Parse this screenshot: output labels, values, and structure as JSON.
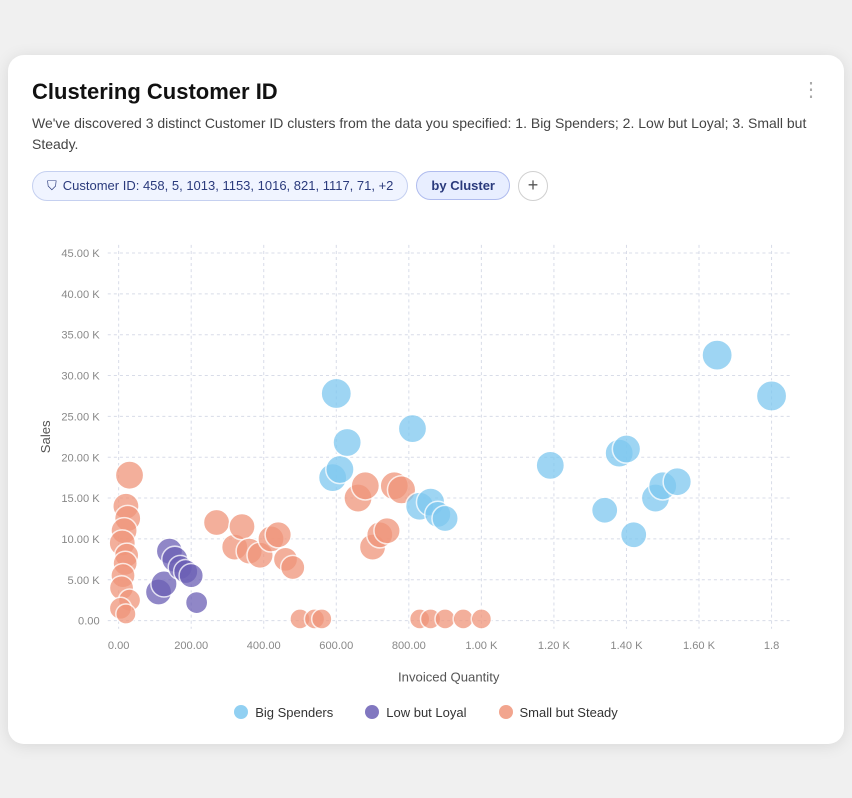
{
  "card": {
    "title": "Clustering Customer ID",
    "description": "We've discovered 3 distinct Customer ID clusters from the data you specified: 1. Big Spenders; 2. Low but Loyal; 3. Small but Steady.",
    "more_icon": "⋮"
  },
  "filter": {
    "icon": "⛉",
    "label": "Customer ID: 458, 5, 1013, 1153, 1016, 821, 1117, 71, +2"
  },
  "cluster_chip": {
    "label": "by Cluster"
  },
  "plus_button": "+",
  "chart": {
    "x_axis_label": "Invoiced Quantity",
    "y_axis_label": "Sales",
    "x_ticks": [
      "0.00",
      "200.00",
      "400.00",
      "600.00",
      "800.00",
      "1.00 K",
      "1.20 K",
      "1.40 K",
      "1.60 K",
      "1.8"
    ],
    "y_ticks": [
      "0.00",
      "5.00 K",
      "10.00 K",
      "15.00 K",
      "20.00 K",
      "25.00 K",
      "30.00 K",
      "35.00 K",
      "40.00 K",
      "45.00 K"
    ]
  },
  "legend": {
    "items": [
      {
        "label": "Big Spenders",
        "color": "#7ec8f0"
      },
      {
        "label": "Low but Loyal",
        "color": "#6b5fb5"
      },
      {
        "label": "Small but Steady",
        "color": "#f0957a"
      }
    ]
  },
  "scatter_points": [
    {
      "x": 30,
      "y": 17800,
      "cluster": 2,
      "r": 14
    },
    {
      "x": 20,
      "y": 14000,
      "cluster": 2,
      "r": 13
    },
    {
      "x": 25,
      "y": 12500,
      "cluster": 2,
      "r": 13
    },
    {
      "x": 15,
      "y": 11000,
      "cluster": 2,
      "r": 13
    },
    {
      "x": 10,
      "y": 9500,
      "cluster": 2,
      "r": 13
    },
    {
      "x": 22,
      "y": 8000,
      "cluster": 2,
      "r": 12
    },
    {
      "x": 18,
      "y": 7000,
      "cluster": 2,
      "r": 12
    },
    {
      "x": 12,
      "y": 5500,
      "cluster": 2,
      "r": 12
    },
    {
      "x": 8,
      "y": 4000,
      "cluster": 2,
      "r": 12
    },
    {
      "x": 30,
      "y": 2500,
      "cluster": 2,
      "r": 11
    },
    {
      "x": 5,
      "y": 1500,
      "cluster": 2,
      "r": 11
    },
    {
      "x": 20,
      "y": 800,
      "cluster": 2,
      "r": 10
    },
    {
      "x": 110,
      "y": 3500,
      "cluster": 1,
      "r": 13
    },
    {
      "x": 125,
      "y": 4500,
      "cluster": 1,
      "r": 13
    },
    {
      "x": 140,
      "y": 8500,
      "cluster": 1,
      "r": 13
    },
    {
      "x": 155,
      "y": 7500,
      "cluster": 1,
      "r": 13
    },
    {
      "x": 170,
      "y": 6500,
      "cluster": 1,
      "r": 12
    },
    {
      "x": 185,
      "y": 6000,
      "cluster": 1,
      "r": 12
    },
    {
      "x": 200,
      "y": 5500,
      "cluster": 1,
      "r": 12
    },
    {
      "x": 215,
      "y": 2200,
      "cluster": 1,
      "r": 11
    },
    {
      "x": 270,
      "y": 12000,
      "cluster": 2,
      "r": 13
    },
    {
      "x": 320,
      "y": 9000,
      "cluster": 2,
      "r": 13
    },
    {
      "x": 340,
      "y": 11500,
      "cluster": 2,
      "r": 13
    },
    {
      "x": 360,
      "y": 8500,
      "cluster": 2,
      "r": 13
    },
    {
      "x": 390,
      "y": 8000,
      "cluster": 2,
      "r": 13
    },
    {
      "x": 420,
      "y": 10000,
      "cluster": 2,
      "r": 13
    },
    {
      "x": 440,
      "y": 10500,
      "cluster": 2,
      "r": 13
    },
    {
      "x": 460,
      "y": 7500,
      "cluster": 2,
      "r": 12
    },
    {
      "x": 480,
      "y": 6500,
      "cluster": 2,
      "r": 12
    },
    {
      "x": 500,
      "y": 200,
      "cluster": 2,
      "r": 10
    },
    {
      "x": 540,
      "y": 200,
      "cluster": 2,
      "r": 10
    },
    {
      "x": 560,
      "y": 200,
      "cluster": 2,
      "r": 10
    },
    {
      "x": 590,
      "y": 17500,
      "cluster": 0,
      "r": 14
    },
    {
      "x": 610,
      "y": 18500,
      "cluster": 0,
      "r": 14
    },
    {
      "x": 630,
      "y": 21800,
      "cluster": 0,
      "r": 14
    },
    {
      "x": 600,
      "y": 27800,
      "cluster": 0,
      "r": 15
    },
    {
      "x": 660,
      "y": 15000,
      "cluster": 2,
      "r": 14
    },
    {
      "x": 680,
      "y": 16500,
      "cluster": 2,
      "r": 14
    },
    {
      "x": 700,
      "y": 9000,
      "cluster": 2,
      "r": 13
    },
    {
      "x": 720,
      "y": 10500,
      "cluster": 2,
      "r": 13
    },
    {
      "x": 740,
      "y": 11000,
      "cluster": 2,
      "r": 13
    },
    {
      "x": 760,
      "y": 16500,
      "cluster": 2,
      "r": 14
    },
    {
      "x": 780,
      "y": 16000,
      "cluster": 2,
      "r": 14
    },
    {
      "x": 810,
      "y": 23500,
      "cluster": 0,
      "r": 14
    },
    {
      "x": 830,
      "y": 14000,
      "cluster": 0,
      "r": 14
    },
    {
      "x": 860,
      "y": 14500,
      "cluster": 0,
      "r": 14
    },
    {
      "x": 880,
      "y": 13000,
      "cluster": 0,
      "r": 13
    },
    {
      "x": 900,
      "y": 12500,
      "cluster": 0,
      "r": 13
    },
    {
      "x": 830,
      "y": 200,
      "cluster": 2,
      "r": 10
    },
    {
      "x": 860,
      "y": 200,
      "cluster": 2,
      "r": 10
    },
    {
      "x": 900,
      "y": 200,
      "cluster": 2,
      "r": 10
    },
    {
      "x": 950,
      "y": 200,
      "cluster": 2,
      "r": 10
    },
    {
      "x": 1000,
      "y": 200,
      "cluster": 2,
      "r": 10
    },
    {
      "x": 1190,
      "y": 19000,
      "cluster": 0,
      "r": 14
    },
    {
      "x": 1340,
      "y": 13500,
      "cluster": 0,
      "r": 13
    },
    {
      "x": 1380,
      "y": 20500,
      "cluster": 0,
      "r": 14
    },
    {
      "x": 1400,
      "y": 21000,
      "cluster": 0,
      "r": 14
    },
    {
      "x": 1420,
      "y": 10500,
      "cluster": 0,
      "r": 13
    },
    {
      "x": 1480,
      "y": 15000,
      "cluster": 0,
      "r": 14
    },
    {
      "x": 1500,
      "y": 16500,
      "cluster": 0,
      "r": 14
    },
    {
      "x": 1540,
      "y": 17000,
      "cluster": 0,
      "r": 14
    },
    {
      "x": 1650,
      "y": 32500,
      "cluster": 0,
      "r": 15
    },
    {
      "x": 1800,
      "y": 27500,
      "cluster": 0,
      "r": 15
    }
  ]
}
